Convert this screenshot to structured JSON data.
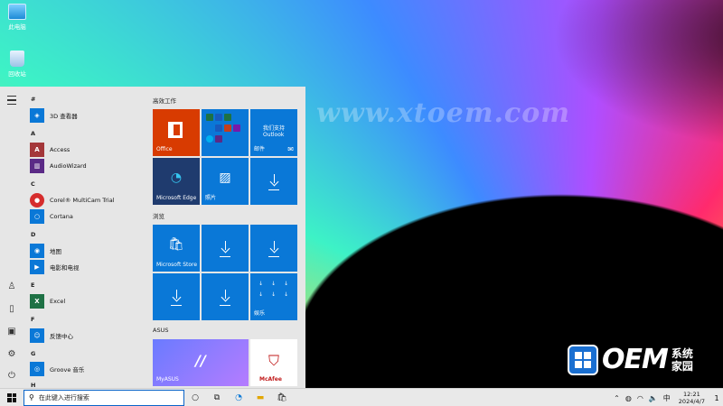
{
  "desktop": {
    "icons": [
      {
        "label": "此电脑",
        "icon": "computer-icon"
      },
      {
        "label": "回收站",
        "icon": "recycle-bin-icon"
      }
    ],
    "watermark": "www.xtoem.com",
    "brand": {
      "text": "OEM",
      "cn_line1": "系统",
      "cn_line2": "家园"
    }
  },
  "start_menu": {
    "rail": [
      "menu-icon",
      "user-icon",
      "documents-icon",
      "pictures-icon",
      "settings-icon",
      "power-icon"
    ],
    "apps": [
      {
        "letter": "#"
      },
      {
        "label": "3D 查看器",
        "icon": "3d-viewer-icon",
        "color": "#0a78d7"
      },
      {
        "letter": "A"
      },
      {
        "label": "Access",
        "icon": "access-icon",
        "color": "#a4373a"
      },
      {
        "label": "AudioWizard",
        "icon": "audiowizard-icon",
        "color": "#5b2a86"
      },
      {
        "letter": "C"
      },
      {
        "label": "Corel® MultiCam Trial",
        "icon": "corel-icon",
        "color": "#d62d2d"
      },
      {
        "label": "Cortana",
        "icon": "cortana-icon",
        "color": "#0a78d7"
      },
      {
        "letter": "D"
      },
      {
        "label": "地图",
        "icon": "maps-icon",
        "color": "#0a78d7"
      },
      {
        "label": "电影和电视",
        "icon": "movies-icon",
        "color": "#0a78d7"
      },
      {
        "letter": "E"
      },
      {
        "label": "Excel",
        "icon": "excel-icon",
        "color": "#1e7145"
      },
      {
        "letter": "F"
      },
      {
        "label": "反馈中心",
        "icon": "feedback-icon",
        "color": "#0a78d7"
      },
      {
        "letter": "G"
      },
      {
        "label": "Groove 音乐",
        "icon": "groove-icon",
        "color": "#0a78d7"
      },
      {
        "letter": "H"
      }
    ],
    "groups": [
      {
        "title": "高效工作"
      },
      {
        "title": "浏览"
      },
      {
        "title": "ASUS"
      }
    ],
    "tiles": {
      "office": "Office",
      "mail_line1": "我们支持",
      "mail_line2": "Outlook",
      "mail": "邮件",
      "edge": "Microsoft Edge",
      "photos": "照片",
      "store": "Microsoft Store",
      "entertainment": "娱乐",
      "myasus": "MyASUS",
      "mcafee": "McAfee"
    }
  },
  "taskbar": {
    "search_placeholder": "在此键入进行搜索",
    "time": "12:21",
    "date": "2024/4/7",
    "ime": "中",
    "notifications": "1"
  },
  "colors": {
    "accent": "#0a78d7",
    "office": "#d83b01",
    "edge_tile": "#1f3b6e",
    "myasus": "#7b61ff",
    "mcafee": "#c01818"
  }
}
